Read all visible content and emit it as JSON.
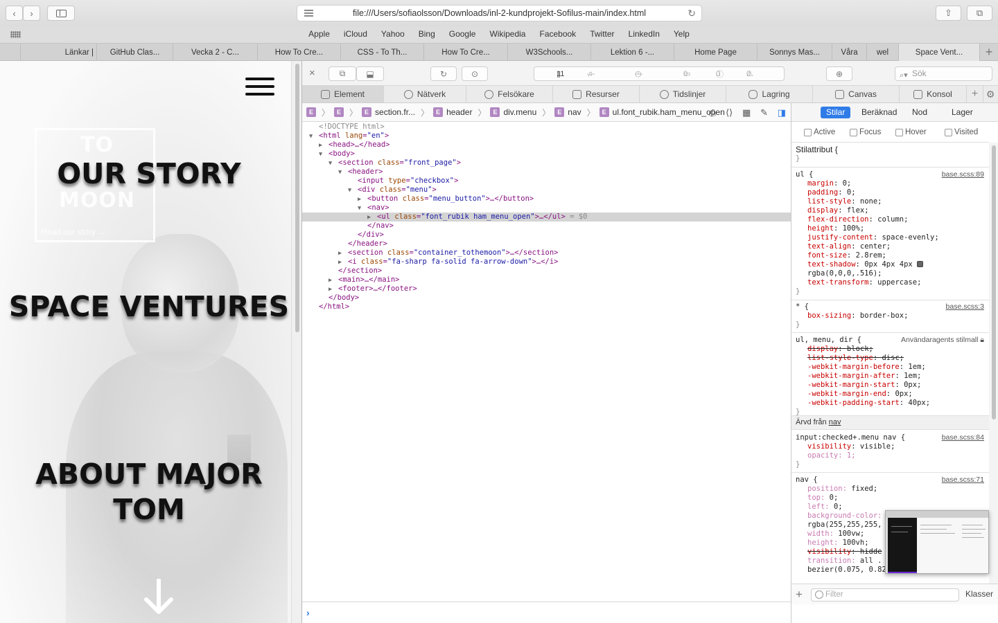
{
  "browser": {
    "url": "file:///Users/sofiaolsson/Downloads/inl-2-kundprojekt-Sofilus-main/index.html",
    "favorites": [
      "Apple",
      "iCloud",
      "Yahoo",
      "Bing",
      "Google",
      "Wikipedia",
      "Facebook",
      "Twitter",
      "LinkedIn",
      "Yelp"
    ],
    "tabs": [
      "Länkar |",
      "GitHub Clas...",
      "Vecka 2 - C...",
      "How To Cre...",
      "CSS - To Th...",
      "How To Cre...",
      "W3Schools...",
      "Lektion 6 -...",
      "Home Page",
      "Sonnys Mas...",
      "Våra",
      "wel",
      "Space Vent..."
    ],
    "active_tab": "Space Vent..."
  },
  "page": {
    "to": "TO",
    "moon": "MOON",
    "read_link": "Read our story →",
    "menu": [
      "OUR STORY",
      "SPACE VENTURES",
      "ABOUT MAJOR TOM"
    ]
  },
  "inspector": {
    "counters": {
      "resources": "11",
      "warnings": "—",
      "time": "—",
      "messages": "0",
      "errors": "0",
      "issues": "0"
    },
    "search_placeholder": "Sök",
    "tabs": [
      "Element",
      "Nätverk",
      "Felsökare",
      "Resurser",
      "Tidslinjer",
      "Lagring",
      "Canvas",
      "Konsol"
    ],
    "active_tab": "Element",
    "breadcrumbs": [
      "section.fr...",
      "header",
      "div.menu",
      "nav",
      "ul.font_rubik.ham_menu_open"
    ],
    "dom": {
      "doctype": "<!DOCTYPE html>",
      "html_tag": "html",
      "lang_attr": "lang",
      "lang_val": "\"en\"",
      "head": "<head>…</head>",
      "body": "body",
      "section_front": "section",
      "class_attr": "class",
      "front_val": "\"front_page\"",
      "header": "header",
      "input": "input",
      "type_attr": "type",
      "checkbox_val": "\"checkbox\"",
      "div": "div",
      "menu_val": "\"menu\"",
      "button": "button",
      "menu_button_val": "\"menu_button\"",
      "button_rest": ">…</button>",
      "nav": "nav",
      "ul": "ul",
      "ul_val": "\"font_rubik ham_menu_open\"",
      "ul_rest": ">…</ul>",
      "ul_marker": "= $0",
      "nav_close": "</nav>",
      "div_close": "</div>",
      "header_close": "</header>",
      "section_container_val": "\"container_tothemoon\"",
      "section_rest": ">…</section>",
      "i": "i",
      "i_val": "\"fa-sharp fa-solid fa-arrow-down\"",
      "i_rest": ">…</i>",
      "section_close": "</section>",
      "main": "<main>…</main>",
      "footer": "<footer>…</footer>",
      "body_close": "</body>",
      "html_close": "</html>"
    },
    "sidebar": {
      "tabs": [
        "Stilar",
        "Beräknad",
        "Nod",
        "Lager"
      ],
      "active_tab": "Stilar",
      "pseudo": [
        "Active",
        "Focus",
        "Hover",
        "Visited"
      ],
      "stilattribut": "Stilattribut {",
      "close_brace": "}",
      "ul_selector": "ul {",
      "ul_source": "base.scss:89",
      "ul_props": [
        [
          "margin",
          "0;"
        ],
        [
          "padding",
          "0;"
        ],
        [
          "list-style",
          "none;"
        ],
        [
          "display",
          "flex;"
        ],
        [
          "flex-direction",
          "column;"
        ],
        [
          "height",
          "100%;"
        ],
        [
          "justify-content",
          "space-evenly;"
        ],
        [
          "text-align",
          "center;"
        ],
        [
          "font-size",
          "2.8rem;"
        ],
        [
          "text-shadow",
          "0px 4px 4px"
        ],
        [
          "text-transform",
          "uppercase;"
        ]
      ],
      "shadow_rgba": "rgba(0,0,0,.516);",
      "star_selector": "* {",
      "star_source": "base.scss:3",
      "star_prop": [
        "box-sizing",
        "border-box;"
      ],
      "ua_selector": "ul, menu, dir {",
      "ua_source": "Användaragents stilmall",
      "ua_props": [
        [
          "display",
          "block;"
        ],
        [
          "list-style-type",
          "disc;"
        ],
        [
          "-webkit-margin-before",
          "1em;"
        ],
        [
          "-webkit-margin-after",
          "1em;"
        ],
        [
          "-webkit-margin-start",
          "0px;"
        ],
        [
          "-webkit-margin-end",
          "0px;"
        ],
        [
          "-webkit-padding-start",
          "40px;"
        ]
      ],
      "inherited_label": "Ärvd från",
      "inherited_from": "nav",
      "checked_selector": "input:checked+.menu nav {",
      "checked_source": "base.scss:84",
      "checked_props": [
        [
          "visibility",
          "visible;"
        ],
        [
          "opacity",
          "1;"
        ]
      ],
      "nav_selector": "nav {",
      "nav_source": "base.scss:71",
      "nav_props": [
        [
          "position",
          "fixed;"
        ],
        [
          "top",
          "0;"
        ],
        [
          "left",
          "0;"
        ],
        [
          "background-color",
          ""
        ]
      ],
      "nav_bg": "rgba(255,255,255,",
      "nav_props2": [
        [
          "width",
          "100vw;"
        ],
        [
          "height",
          "100vh;"
        ],
        [
          "visibility",
          "hidde"
        ],
        [
          "transition",
          "all ."
        ]
      ],
      "bezier": "bezier(0.075, 0.82, 0.165, 1);",
      "filter_placeholder": "Filter",
      "klasser": "Klasser"
    }
  }
}
